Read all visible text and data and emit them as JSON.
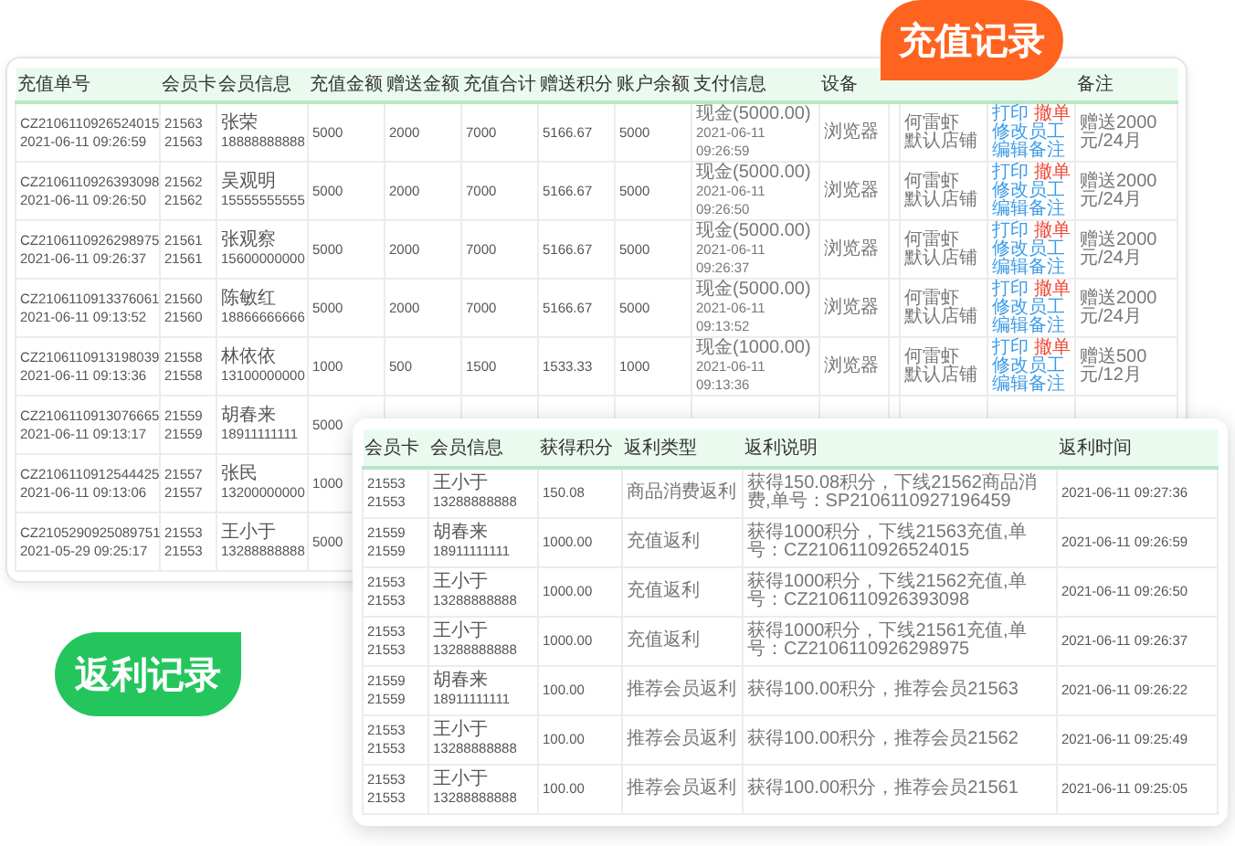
{
  "recharge_bubble": {
    "label": "充值记录"
  },
  "recharge_table": {
    "columns": [
      "充值单号",
      "会员卡",
      "会员信息",
      "充值金额",
      "赠送金额",
      "充值合计",
      "赠送积分",
      "账户余额",
      "支付信息",
      "设备",
      "备注"
    ],
    "rows": [
      {
        "order_no": "CZ2106110926524015",
        "order_time": "2021-06-11 09:26:59",
        "card": [
          "21563",
          "21563"
        ],
        "name": "张荣",
        "phone": "18888888888",
        "recharge": "5000",
        "bonus": "2000",
        "total": "7000",
        "points": "5166.67",
        "balance": "5000",
        "payment": [
          "现金(5000.00)",
          "2021-06-11",
          "09:26:59"
        ],
        "device": "浏览器",
        "staff": [
          "何雷虾",
          "默认店铺"
        ],
        "actions": [
          {
            "label": "打印",
            "kind": "link"
          },
          {
            "label": "撤单",
            "kind": "danger"
          },
          {
            "label": "修改员工",
            "kind": "link"
          },
          {
            "label": "编辑备注",
            "kind": "link"
          }
        ],
        "note": "赠送2000元/24月"
      },
      {
        "order_no": "CZ2106110926393098",
        "order_time": "2021-06-11 09:26:50",
        "card": [
          "21562",
          "21562"
        ],
        "name": "吴观明",
        "phone": "15555555555",
        "recharge": "5000",
        "bonus": "2000",
        "total": "7000",
        "points": "5166.67",
        "balance": "5000",
        "payment": [
          "现金(5000.00)",
          "2021-06-11",
          "09:26:50"
        ],
        "device": "浏览器",
        "staff": [
          "何雷虾",
          "默认店铺"
        ],
        "actions": [
          {
            "label": "打印",
            "kind": "link"
          },
          {
            "label": "撤单",
            "kind": "danger"
          },
          {
            "label": "修改员工",
            "kind": "link"
          },
          {
            "label": "编辑备注",
            "kind": "link"
          }
        ],
        "note": "赠送2000元/24月"
      },
      {
        "order_no": "CZ2106110926298975",
        "order_time": "2021-06-11 09:26:37",
        "card": [
          "21561",
          "21561"
        ],
        "name": "张观察",
        "phone": "15600000000",
        "recharge": "5000",
        "bonus": "2000",
        "total": "7000",
        "points": "5166.67",
        "balance": "5000",
        "payment": [
          "现金(5000.00)",
          "2021-06-11",
          "09:26:37"
        ],
        "device": "浏览器",
        "staff": [
          "何雷虾",
          "默认店铺"
        ],
        "actions": [
          {
            "label": "打印",
            "kind": "link"
          },
          {
            "label": "撤单",
            "kind": "danger"
          },
          {
            "label": "修改员工",
            "kind": "link"
          },
          {
            "label": "编辑备注",
            "kind": "link"
          }
        ],
        "note": "赠送2000元/24月"
      },
      {
        "order_no": "CZ2106110913376061",
        "order_time": "2021-06-11 09:13:52",
        "card": [
          "21560",
          "21560"
        ],
        "name": "陈敏红",
        "phone": "18866666666",
        "recharge": "5000",
        "bonus": "2000",
        "total": "7000",
        "points": "5166.67",
        "balance": "5000",
        "payment": [
          "现金(5000.00)",
          "2021-06-11",
          "09:13:52"
        ],
        "device": "浏览器",
        "staff": [
          "何雷虾",
          "默认店铺"
        ],
        "actions": [
          {
            "label": "打印",
            "kind": "link"
          },
          {
            "label": "撤单",
            "kind": "danger"
          },
          {
            "label": "修改员工",
            "kind": "link"
          },
          {
            "label": "编辑备注",
            "kind": "link"
          }
        ],
        "note": "赠送2000元/24月"
      },
      {
        "order_no": "CZ2106110913198039",
        "order_time": "2021-06-11 09:13:36",
        "card": [
          "21558",
          "21558"
        ],
        "name": "林依依",
        "phone": "13100000000",
        "recharge": "1000",
        "bonus": "500",
        "total": "1500",
        "points": "1533.33",
        "balance": "1000",
        "payment": [
          "现金(1000.00)",
          "2021-06-11",
          "09:13:36"
        ],
        "device": "浏览器",
        "staff": [
          "何雷虾",
          "默认店铺"
        ],
        "actions": [
          {
            "label": "打印",
            "kind": "link"
          },
          {
            "label": "撤单",
            "kind": "danger"
          },
          {
            "label": "修改员工",
            "kind": "link"
          },
          {
            "label": "编辑备注",
            "kind": "link"
          }
        ],
        "note": "赠送500元/12月"
      },
      {
        "order_no": "CZ2106110913076665",
        "order_time": "2021-06-11 09:13:17",
        "card": [
          "21559",
          "21559"
        ],
        "name": "胡春来",
        "phone": "18911111111",
        "recharge": "5000"
      },
      {
        "order_no": "CZ2106110912544425",
        "order_time": "2021-06-11 09:13:06",
        "card": [
          "21557",
          "21557"
        ],
        "name": "张民",
        "phone": "13200000000",
        "recharge": "1000"
      },
      {
        "order_no": "CZ2105290925089751",
        "order_time": "2021-05-29 09:25:17",
        "card": [
          "21553",
          "21553"
        ],
        "name": "王小于",
        "phone": "13288888888",
        "recharge": "5000"
      }
    ]
  },
  "rebate_bubble": {
    "label": "返利记录"
  },
  "rebate_table": {
    "columns": [
      "会员卡",
      "会员信息",
      "获得积分",
      "返利类型",
      "返利说明",
      "返利时间"
    ],
    "rows": [
      {
        "card": [
          "21553",
          "21553"
        ],
        "name": "王小于",
        "phone": "13288888888",
        "points": "150.08",
        "type": "商品消费返利",
        "description": "获得150.08积分，下线21562商品消费,单号：SP2106110927196459",
        "time": "2021-06-11 09:27:36"
      },
      {
        "card": [
          "21559",
          "21559"
        ],
        "name": "胡春来",
        "phone": "18911111111",
        "points": "1000.00",
        "type": "充值返利",
        "description": "获得1000积分，下线21563充值,单号：CZ2106110926524015",
        "time": "2021-06-11 09:26:59"
      },
      {
        "card": [
          "21553",
          "21553"
        ],
        "name": "王小于",
        "phone": "13288888888",
        "points": "1000.00",
        "type": "充值返利",
        "description": "获得1000积分，下线21562充值,单号：CZ2106110926393098",
        "time": "2021-06-11 09:26:50"
      },
      {
        "card": [
          "21553",
          "21553"
        ],
        "name": "王小于",
        "phone": "13288888888",
        "points": "1000.00",
        "type": "充值返利",
        "description": "获得1000积分，下线21561充值,单号：CZ2106110926298975",
        "time": "2021-06-11 09:26:37"
      },
      {
        "card": [
          "21559",
          "21559"
        ],
        "name": "胡春来",
        "phone": "18911111111",
        "points": "100.00",
        "type": "推荐会员返利",
        "description": "获得100.00积分，推荐会员21563",
        "time": "2021-06-11 09:26:22"
      },
      {
        "card": [
          "21553",
          "21553"
        ],
        "name": "王小于",
        "phone": "13288888888",
        "points": "100.00",
        "type": "推荐会员返利",
        "description": "获得100.00积分，推荐会员21562",
        "time": "2021-06-11 09:25:49"
      },
      {
        "card": [
          "21553",
          "21553"
        ],
        "name": "王小于",
        "phone": "13288888888",
        "points": "100.00",
        "type": "推荐会员返利",
        "description": "获得100.00积分，推荐会员21561",
        "time": "2021-06-11 09:25:05"
      }
    ]
  }
}
